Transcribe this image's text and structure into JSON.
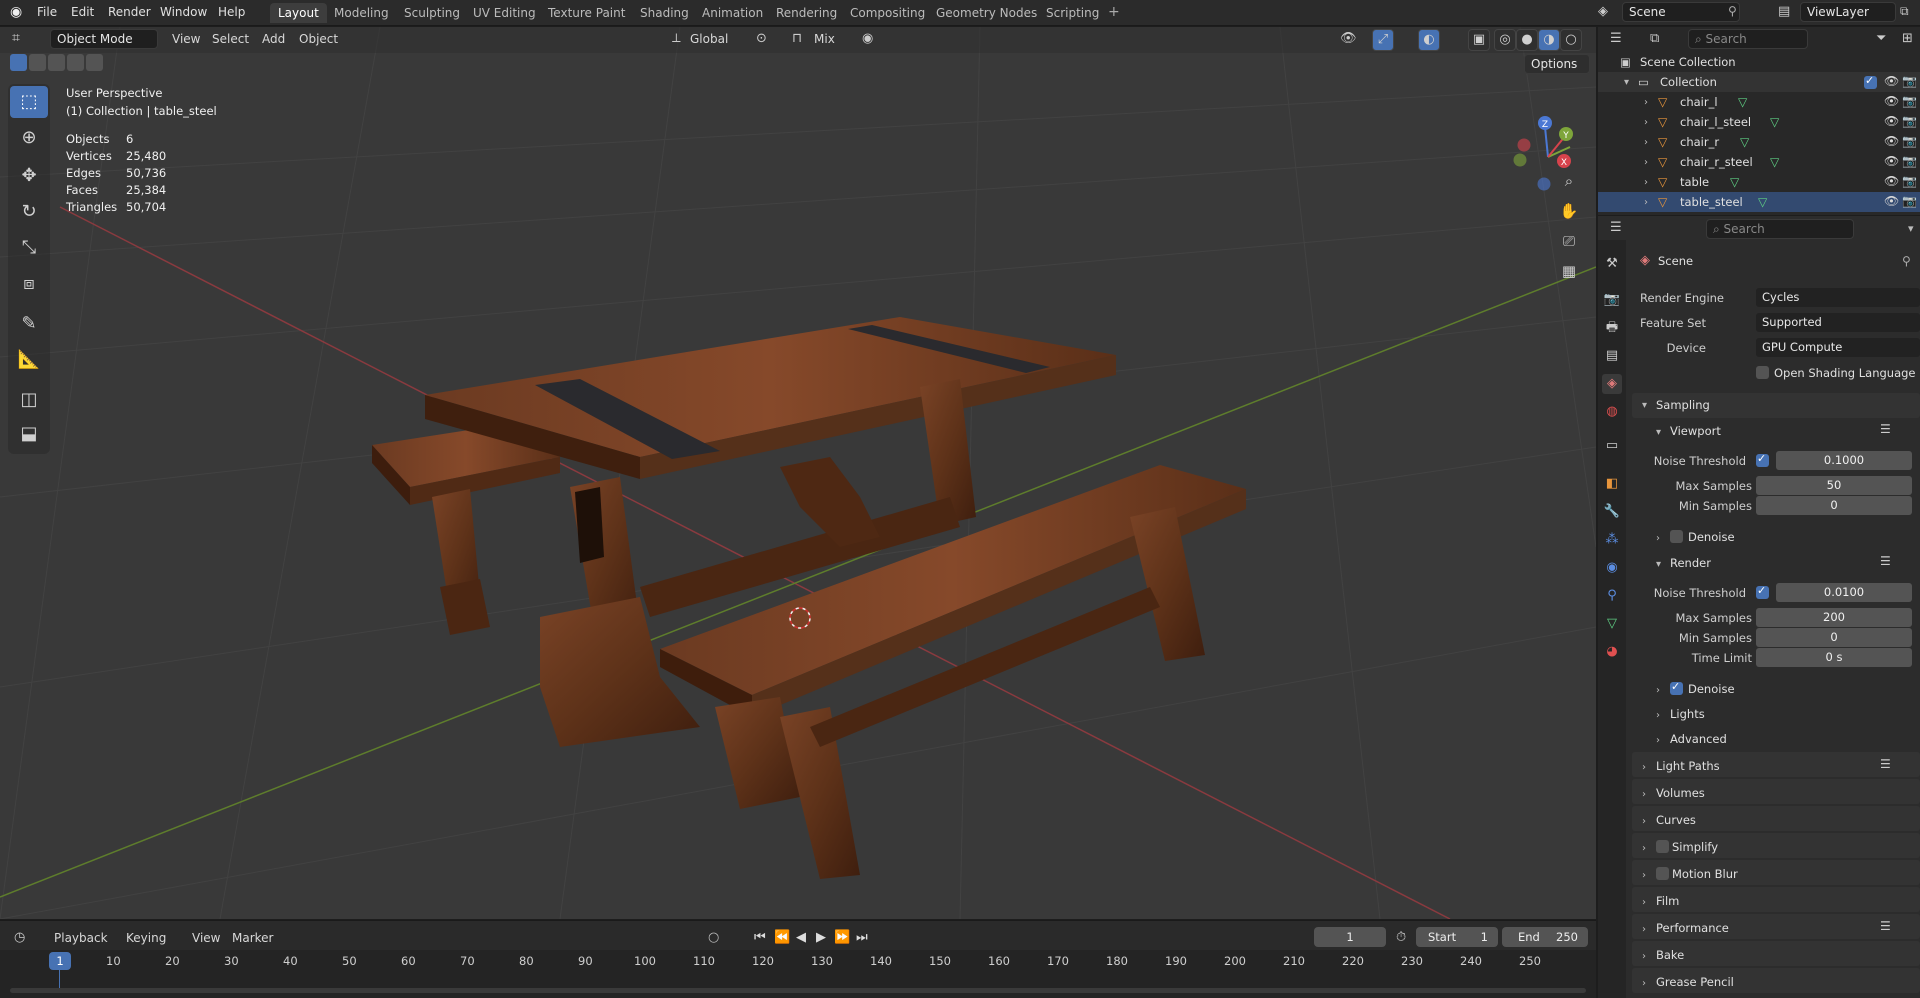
{
  "topbar": {
    "menus": [
      "File",
      "Edit",
      "Render",
      "Window",
      "Help"
    ],
    "workspaces": [
      "Layout",
      "Modeling",
      "Sculpting",
      "UV Editing",
      "Texture Paint",
      "Shading",
      "Animation",
      "Rendering",
      "Compositing",
      "Geometry Nodes",
      "Scripting"
    ],
    "active_workspace": "Layout",
    "scene": "Scene",
    "view_layer": "ViewLayer"
  },
  "viewport_header": {
    "mode": "Object Mode",
    "menus": [
      "View",
      "Select",
      "Add",
      "Object"
    ],
    "orientation": "Global",
    "snap": "Mix",
    "options": "Options"
  },
  "overlay": {
    "perspective": "User Perspective",
    "collection_path": "(1) Collection | table_steel",
    "stats": [
      {
        "label": "Objects",
        "value": "6"
      },
      {
        "label": "Vertices",
        "value": "25,480"
      },
      {
        "label": "Edges",
        "value": "50,736"
      },
      {
        "label": "Faces",
        "value": "25,384"
      },
      {
        "label": "Triangles",
        "value": "50,704"
      }
    ],
    "gizmo_axes": [
      "Z",
      "Y",
      "X"
    ]
  },
  "outliner": {
    "search_placeholder": "Search",
    "scene_collection": "Scene Collection",
    "collection": "Collection",
    "items": [
      "chair_l",
      "chair_l_steel",
      "chair_r",
      "chair_r_steel",
      "table",
      "table_steel"
    ]
  },
  "properties": {
    "search_placeholder": "Search",
    "context": "Scene",
    "render_engine_label": "Render Engine",
    "render_engine": "Cycles",
    "feature_set_label": "Feature Set",
    "feature_set": "Supported",
    "device_label": "Device",
    "device": "GPU Compute",
    "osl": "Open Shading Language",
    "sampling": "Sampling",
    "viewport": "Viewport",
    "vp_noise_label": "Noise Threshold",
    "vp_noise": "0.1000",
    "vp_max_label": "Max Samples",
    "vp_max": "50",
    "vp_min_label": "Min Samples",
    "vp_min": "0",
    "vp_denoise": "Denoise",
    "render": "Render",
    "r_noise_label": "Noise Threshold",
    "r_noise": "0.0100",
    "r_max_label": "Max Samples",
    "r_max": "200",
    "r_min_label": "Min Samples",
    "r_min": "0",
    "r_time_label": "Time Limit",
    "r_time": "0 s",
    "r_denoise": "Denoise",
    "lights": "Lights",
    "advanced": "Advanced",
    "panels": [
      "Light Paths",
      "Volumes",
      "Curves",
      "Simplify",
      "Motion Blur",
      "Film",
      "Performance",
      "Bake",
      "Grease Pencil"
    ]
  },
  "timeline": {
    "menus": [
      "Playback",
      "Keying",
      "View",
      "Marker"
    ],
    "current_frame": "1",
    "start_label": "Start",
    "start": "1",
    "end_label": "End",
    "end": "250",
    "ticks": [
      "1",
      "10",
      "20",
      "30",
      "40",
      "50",
      "60",
      "70",
      "80",
      "90",
      "100",
      "110",
      "120",
      "130",
      "140",
      "150",
      "160",
      "170",
      "180",
      "190",
      "200",
      "210",
      "220",
      "230",
      "240",
      "250"
    ]
  }
}
